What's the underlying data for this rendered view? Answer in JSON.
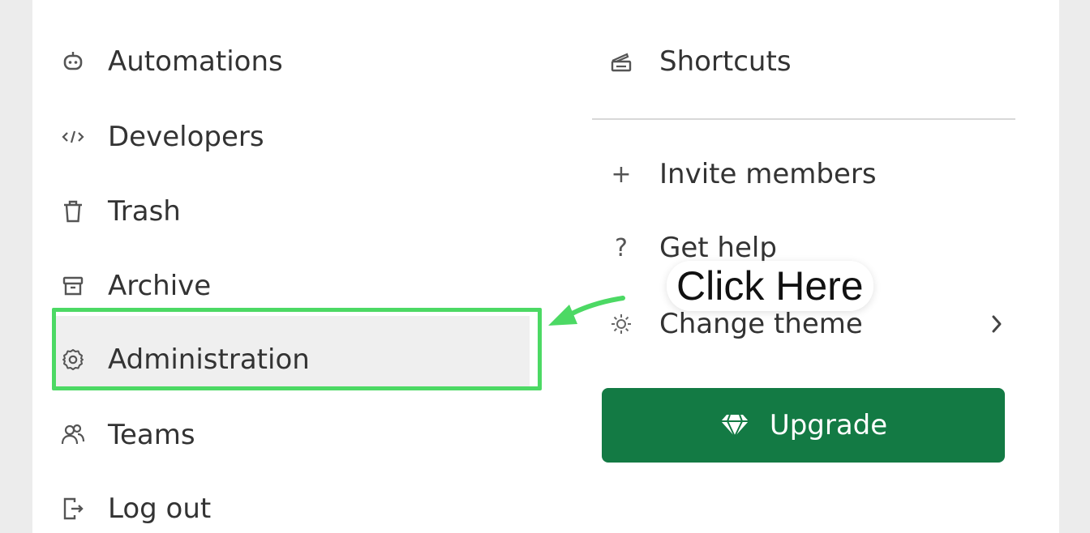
{
  "left_menu": {
    "items": [
      {
        "label": "Automations",
        "icon": "robot-icon"
      },
      {
        "label": "Developers",
        "icon": "code-icon"
      },
      {
        "label": "Trash",
        "icon": "trash-icon"
      },
      {
        "label": "Archive",
        "icon": "archive-icon"
      },
      {
        "label": "Administration",
        "icon": "gear-icon"
      },
      {
        "label": "Teams",
        "icon": "users-icon"
      },
      {
        "label": "Log out",
        "icon": "logout-icon"
      }
    ]
  },
  "right_menu": {
    "shortcuts": {
      "label": "Shortcuts",
      "icon": "keyboard-icon"
    },
    "invite": {
      "label": "Invite members",
      "icon": "plus-icon",
      "glyph": "+"
    },
    "help": {
      "label": "Get help",
      "icon": "question-icon",
      "glyph": "?"
    },
    "theme": {
      "label": "Change theme",
      "icon": "sun-icon"
    },
    "upgrade": {
      "label": "Upgrade",
      "icon": "diamond-icon"
    }
  },
  "annotation": {
    "callout_text": "Click Here",
    "highlight_color": "#4cd964"
  },
  "colors": {
    "upgrade_bg": "#137a44",
    "highlight": "#4cd964"
  }
}
